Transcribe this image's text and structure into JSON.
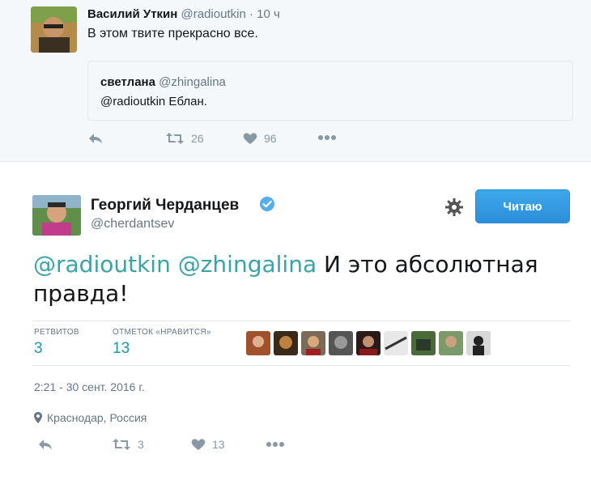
{
  "top_tweet": {
    "name": "Василий Уткин",
    "handle": "@radioutkin",
    "separator": "·",
    "time": "10 ч",
    "text": "В этом твите прекрасно все.",
    "quote": {
      "name": "светлана",
      "handle": "@zhingalina",
      "text": "@radioutkin Еблан."
    },
    "actions": {
      "retweets": "26",
      "likes": "96"
    }
  },
  "main_tweet": {
    "name": "Георгий Черданцев",
    "handle": "@cherdantsev",
    "follow_label": "Читаю",
    "text_mention_1": "@radioutkin",
    "text_mention_2": "@zhingalina",
    "text_body": "И это абсолютная правда!",
    "stats": {
      "retweets_label": "РЕТВИТОВ",
      "retweets_value": "3",
      "likes_label": "ОТМЕТОК «НРАВИТСЯ»",
      "likes_value": "13"
    },
    "timestamp": "2:21 - 30 сент. 2016 г.",
    "location": "Краснодар, Россия",
    "actions": {
      "retweets": "3",
      "likes": "13"
    }
  },
  "colors": {
    "accent_blue": "#2b8fd9",
    "mention_teal": "#3ba3a6",
    "muted_gray": "#657786",
    "icon_gray": "#8899a6"
  },
  "icons": [
    "reply-icon",
    "retweet-icon",
    "heart-icon",
    "more-icon",
    "gear-icon",
    "verified-icon",
    "location-pin-icon"
  ]
}
